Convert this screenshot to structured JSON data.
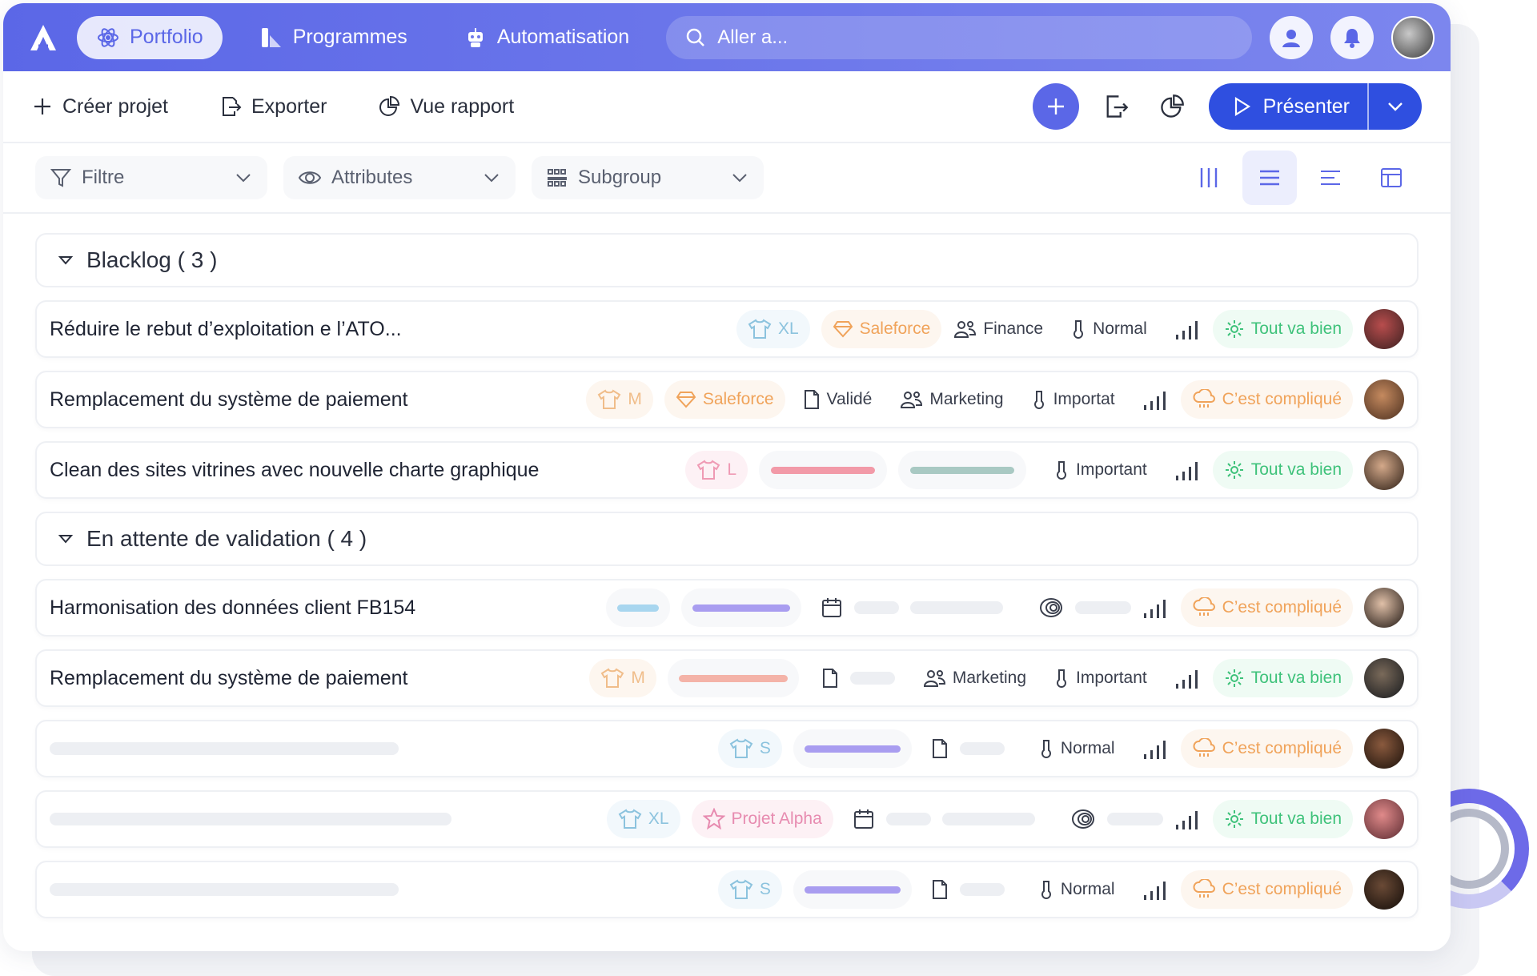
{
  "topbar": {
    "nav": [
      {
        "label": "Portfolio",
        "icon": "atom-icon",
        "active": true
      },
      {
        "label": "Programmes",
        "icon": "programs-icon",
        "active": false
      },
      {
        "label": "Automatisation",
        "icon": "robot-icon",
        "active": false
      }
    ],
    "search_placeholder": "Aller a..."
  },
  "toolbar": {
    "create": "Créer projet",
    "export": "Exporter",
    "report": "Vue rapport",
    "present": "Présenter"
  },
  "filters": {
    "filter": "Filtre",
    "attributes": "Attributes",
    "subgroup": "Subgroup"
  },
  "groups": [
    {
      "label": "Blacklog ( 3 )"
    },
    {
      "label": "En attente de validation ( 4 )"
    }
  ],
  "rows": {
    "r1": {
      "title": "Réduire le rebut d’exploitation e l’ATO...",
      "size": "XL",
      "tag": "Saleforce",
      "team": "Finance",
      "priority": "Normal",
      "status": "Tout va bien"
    },
    "r2": {
      "title": "Remplacement du système de paiement",
      "size": "M",
      "tag": "Saleforce",
      "doc": "Validé",
      "team": "Marketing",
      "priority": "Importat",
      "status": "C’est compliqué"
    },
    "r3": {
      "title": "Clean des sites vitrines avec nouvelle charte graphique",
      "size": "L",
      "priority": "Important",
      "status": "Tout va bien"
    },
    "r4": {
      "title": "Harmonisation des données client FB154",
      "status": "C’est compliqué"
    },
    "r5": {
      "title": "Remplacement du système de paiement",
      "size": "M",
      "team": "Marketing",
      "priority": "Important",
      "status": "Tout va bien"
    },
    "r6": {
      "size": "S",
      "priority": "Normal",
      "status": "C’est compliqué"
    },
    "r7": {
      "size": "XL",
      "tag": "Projet Alpha",
      "status": "Tout va bien"
    },
    "r8": {
      "size": "S",
      "priority": "Normal",
      "status": "C’est compliqué"
    }
  },
  "colors": {
    "brand": "#5b67e7",
    "present": "#2f4fe0",
    "ok": "#3ec27a",
    "warn": "#f0a35a"
  }
}
